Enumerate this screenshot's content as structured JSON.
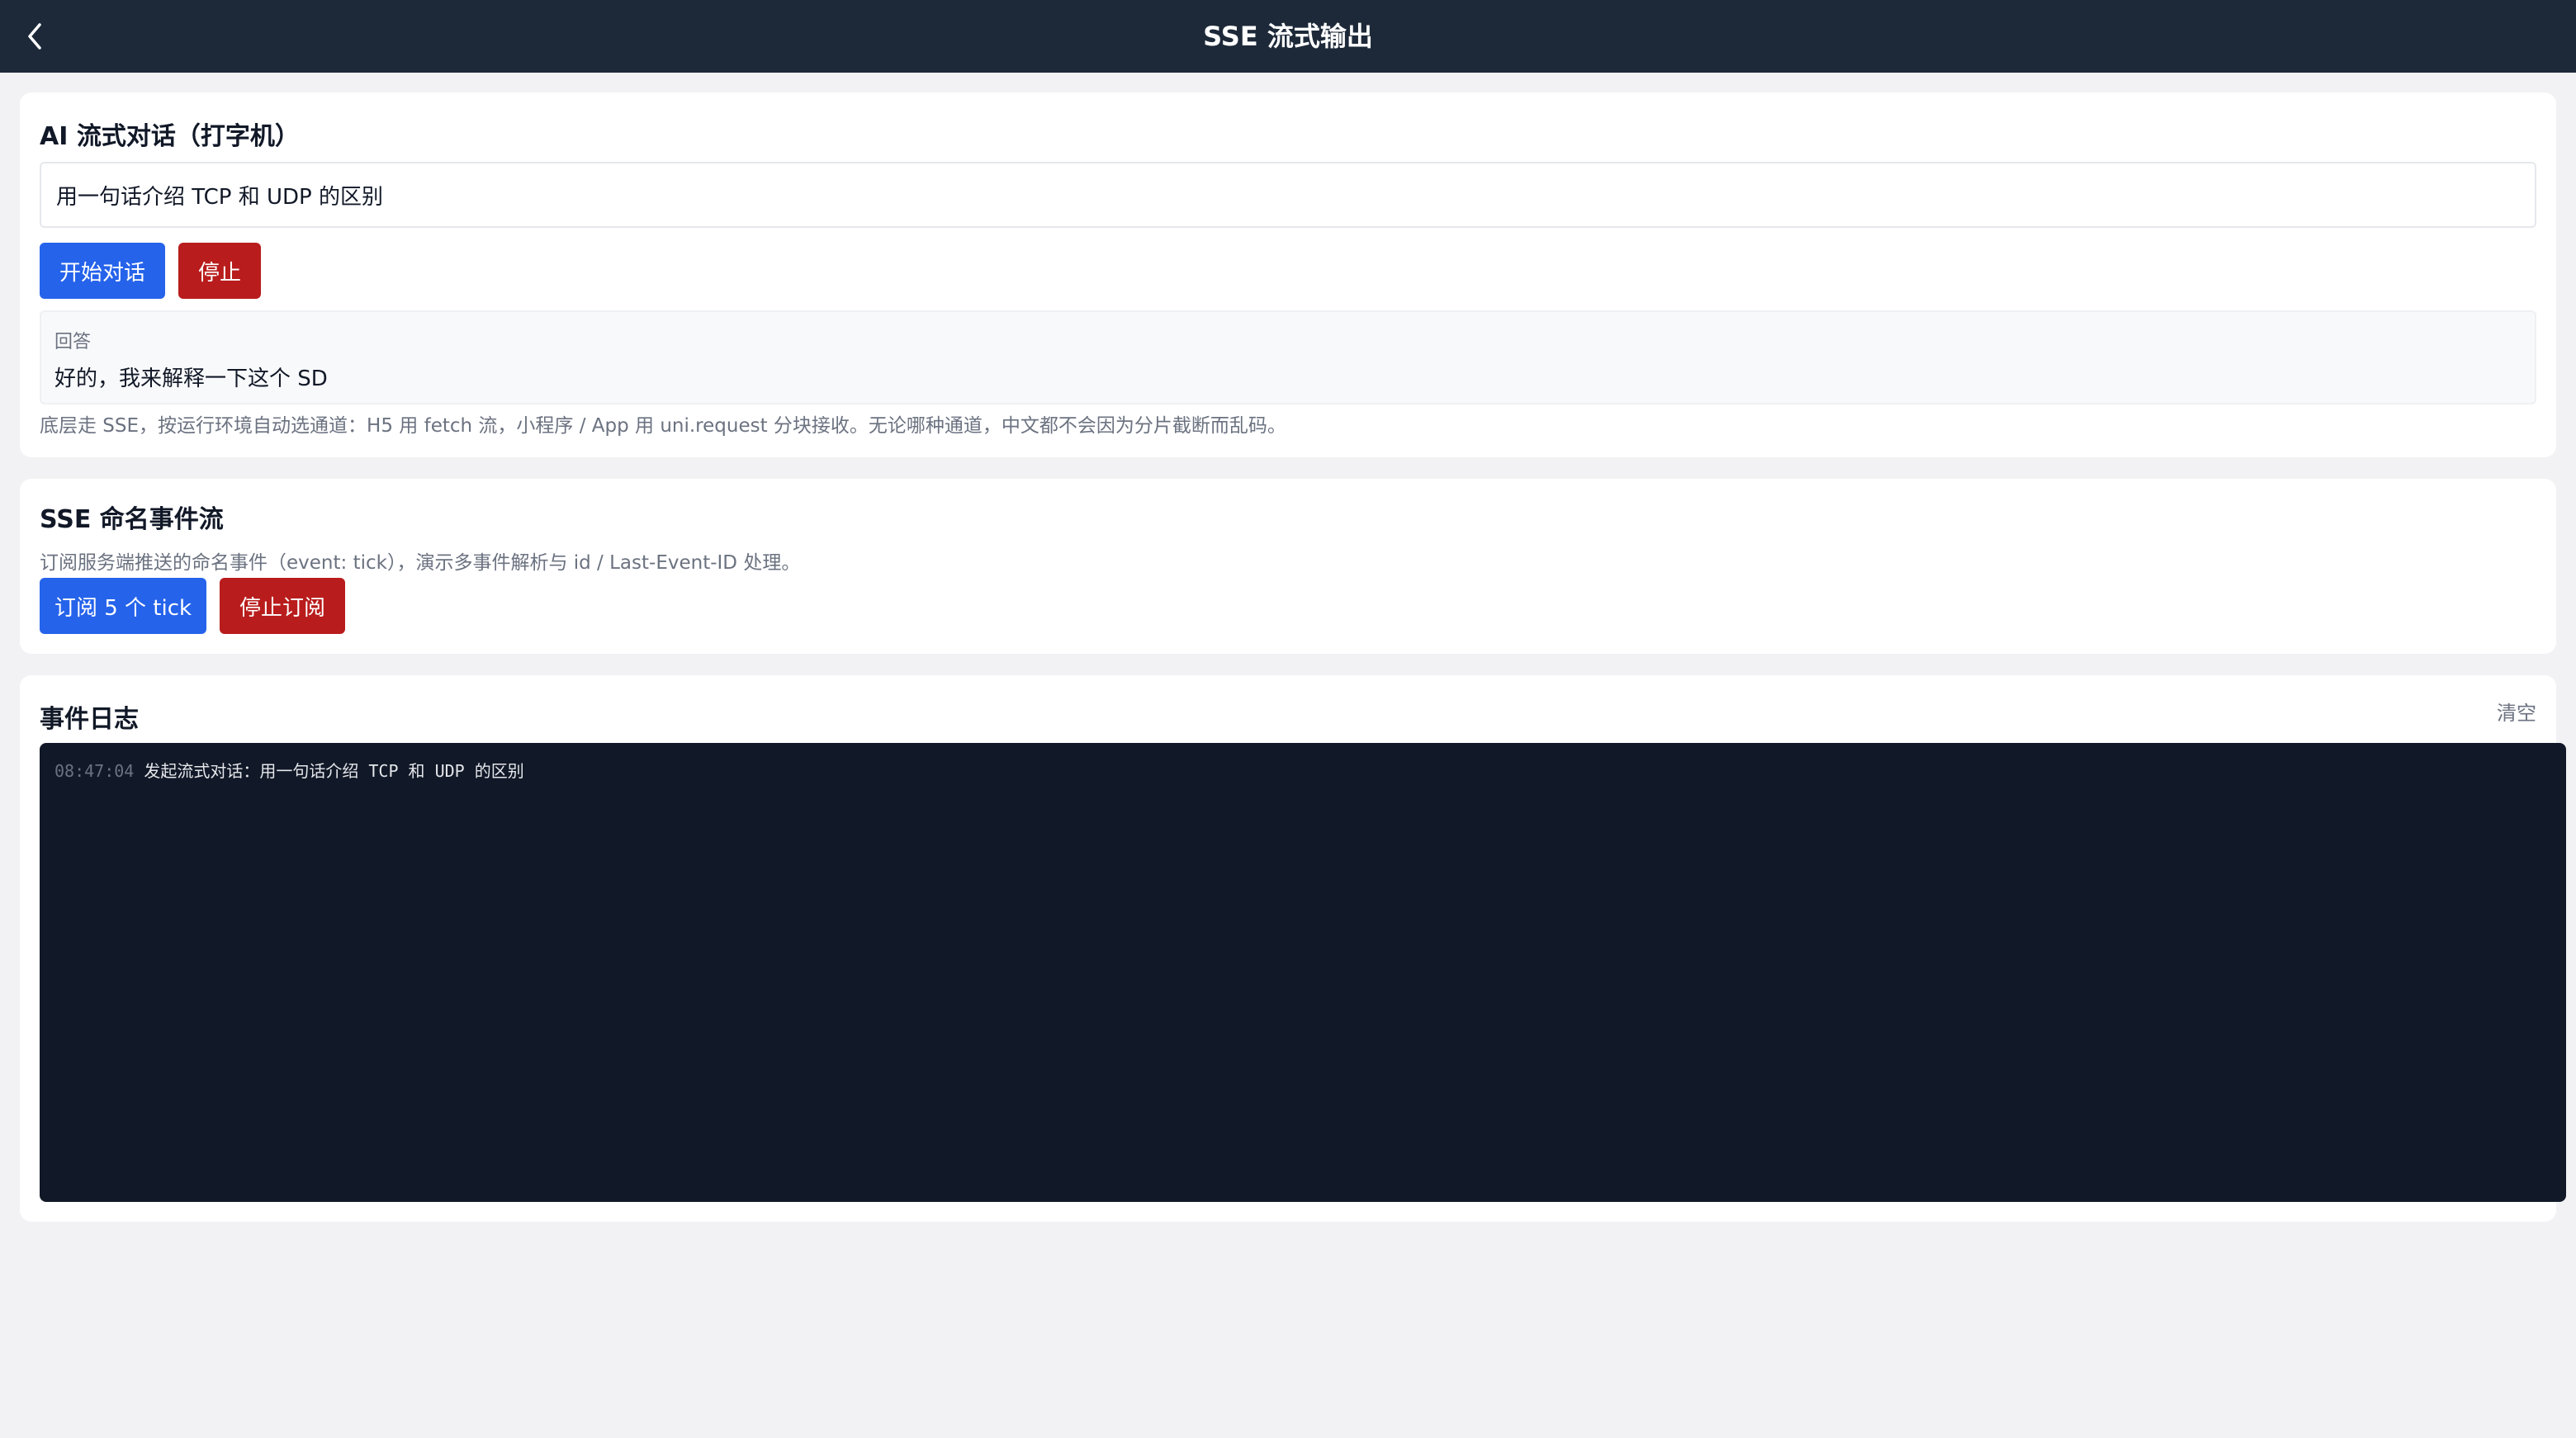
{
  "header": {
    "title": "SSE 流式输出",
    "back_icon": "chevron-left-icon"
  },
  "chat": {
    "title": "AI 流式对话（打字机）",
    "input_value": "用一句话介绍 TCP 和 UDP 的区别",
    "start_label": "开始对话",
    "stop_label": "停止",
    "answer_label": "回答",
    "answer_text": "好的，我来解释一下这个 SD",
    "hint": "底层走 SSE，按运行环境自动选通道：H5 用 fetch 流，小程序 / App 用 uni.request 分块接收。无论哪种通道，中文都不会因为分片截断而乱码。"
  },
  "events": {
    "title": "SSE 命名事件流",
    "desc": "订阅服务端推送的命名事件（event: tick），演示多事件解析与 id / Last-Event-ID 处理。",
    "subscribe_label": "订阅 5 个 tick",
    "unsubscribe_label": "停止订阅"
  },
  "log": {
    "title": "事件日志",
    "clear_label": "清空",
    "entries": [
      {
        "time": "08:47:04",
        "message": "发起流式对话：用一句话介绍 TCP 和 UDP 的区别"
      }
    ]
  },
  "colors": {
    "header_bg": "#1d2939",
    "primary": "#2563eb",
    "danger": "#b91c1c",
    "log_bg": "#111827"
  }
}
